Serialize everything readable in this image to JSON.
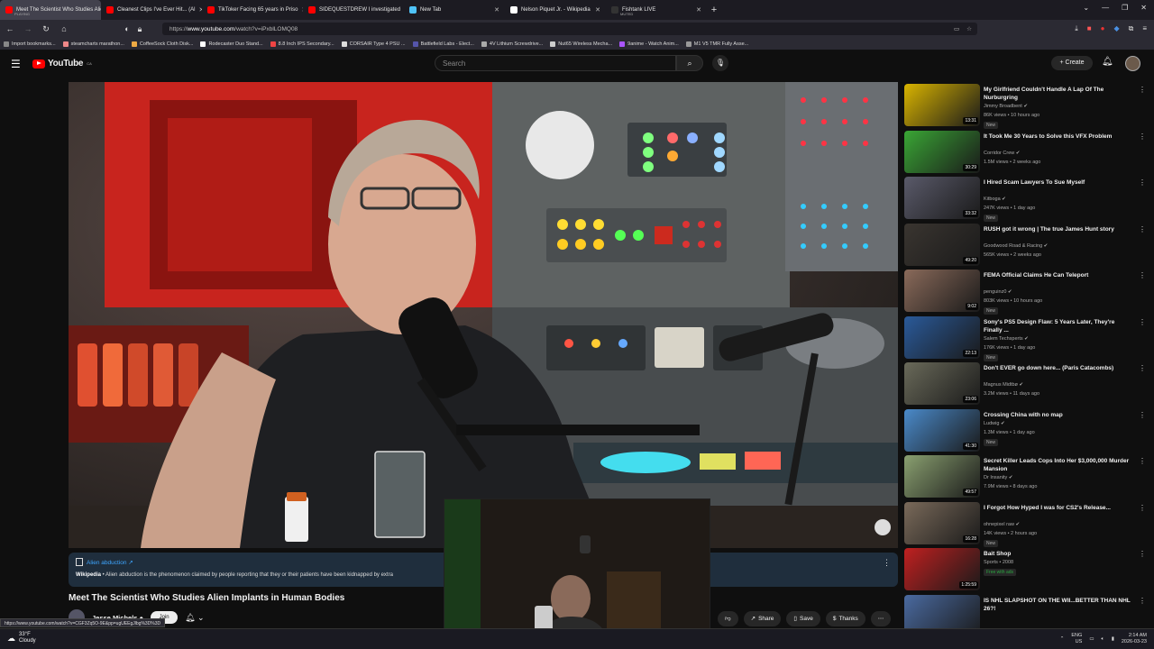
{
  "browser": {
    "tabs": [
      {
        "title": "Meet The Scientist Who Studies Alien",
        "sub": "PLAYING",
        "active": true,
        "color": "#ff0000"
      },
      {
        "title": "Cleanest Clips I've Ever Hit... (Al",
        "color": "#ff0000"
      },
      {
        "title": "TikToker Facing 65 years in Priso",
        "color": "#ff0000"
      },
      {
        "title": "SIDEQUESTDREW I investigated",
        "color": "#ff0000"
      },
      {
        "title": "New Tab",
        "color": "#4fc3f7"
      },
      {
        "title": "Nelson Piquet Jr. - Wikipedia",
        "color": "#ffffff"
      },
      {
        "title": "Fishtank LIVE",
        "sub": "MUTED",
        "color": "#333333"
      }
    ],
    "url_prefix": "https://",
    "url_domain": "www.youtube.com",
    "url_rest": "/watch?v=iPxblLOMQ08",
    "bookmarks": [
      "Import bookmarks...",
      "steamcharts marathon...",
      "CoffeeSock Cloth Disk...",
      "Rodecaster Duo Stand...",
      "8.8 Inch IPS Secondary...",
      "CORSAIR Type 4 PSU ...",
      "Battlefield Labs - Elect...",
      "4V Lithium Screwdrive...",
      "Nut65 Wireless Mecha...",
      "9anime - Watch Anim...",
      "M1 V5 TMR Fully Asse..."
    ],
    "status_url": "https://www.youtube.com/watch?v=CGF3Zq5O-9E&pp=ugUEEgJlbg%3D%3D"
  },
  "youtube": {
    "logo": "YouTube",
    "region": "CA",
    "search_placeholder": "Search",
    "create_label": "+ Create",
    "infocard": {
      "title": "Alien abduction ↗",
      "source": "Wikipedia",
      "text": " • Alien abduction is the phenomenon claimed by people reporting that they or their patients have been kidnapped by extra"
    },
    "video_title": "Meet The Scientist Who Studies Alien Implants in Human Bodies",
    "channel_name": "Jesse Michels ●",
    "subscribe_label": "Join",
    "actions": {
      "share": "Share",
      "save": "Save",
      "thanks": "Thanks"
    }
  },
  "recommendations": [
    {
      "title": "My Girlfriend Couldn't Handle A Lap Of The Nurburgring",
      "channel": "Jimmy Broadbent ✔",
      "meta": "86K views • 10 hours ago",
      "badge": "New",
      "duration": "13:31",
      "color": "#d9b400"
    },
    {
      "title": "It Took Me 30 Years to Solve this VFX Problem",
      "channel": "Corridor Crew ✔",
      "meta": "1.5M views • 2 weeks ago",
      "duration": "30:29",
      "color": "#3aa635"
    },
    {
      "title": "I Hired Scam Lawyers To Sue Myself",
      "channel": "Kitboga ✔",
      "meta": "247K views • 1 day ago",
      "badge": "New",
      "duration": "33:32",
      "color": "#5a5a6a"
    },
    {
      "title": "RUSH got it wrong | The true James Hunt story",
      "channel": "Goodwood Road & Racing ✔",
      "meta": "565K views • 2 weeks ago",
      "duration": "49:20",
      "color": "#3a3530"
    },
    {
      "title": "FEMA Official Claims He Can Teleport",
      "channel": "penguinz0 ✔",
      "meta": "803K views • 10 hours ago",
      "badge": "New",
      "duration": "9:02",
      "color": "#8a6a5a"
    },
    {
      "title": "Sony's PS5 Design Flaw: 5 Years Later, They're Finally ...",
      "channel": "Salem Techsperts ✔",
      "meta": "176K views • 1 day ago",
      "badge": "New",
      "duration": "22:13",
      "color": "#2a5a9a"
    },
    {
      "title": "Don't EVER go down here... (Paris Catacombs)",
      "channel": "Magnus Midtbø ✔",
      "meta": "3.2M views • 11 days ago",
      "duration": "23:06",
      "color": "#6a6a5a"
    },
    {
      "title": "Crossing China with no map",
      "channel": "Ludwig ✔",
      "meta": "1.3M views • 1 day ago",
      "badge": "New",
      "duration": "41:30",
      "color": "#4a8aca"
    },
    {
      "title": "Secret Killer Leads Cops Into Her $3,000,000 Murder Mansion",
      "channel": "Dr Insanity ✔",
      "meta": "7.9M views • 8 days ago",
      "duration": "49:57",
      "color": "#8aa070"
    },
    {
      "title": "I Forgot How Hyped I was for CS2's Release...",
      "channel": "ohnepixel raw ✔",
      "meta": "14K views • 2 hours ago",
      "badge": "New",
      "duration": "16:28",
      "color": "#7a6a5a"
    },
    {
      "title": "Bait Shop",
      "channel": "Sports • 2008",
      "meta": "",
      "badge": "Free with ads",
      "badge_green": true,
      "duration": "1:25:59",
      "color": "#c02020"
    },
    {
      "title": "IS NHL SLAPSHOT ON THE WII...BETTER THAN NHL 26?!",
      "channel": "",
      "meta": "",
      "duration": "",
      "color": "#4a6aa0"
    }
  ],
  "taskbar": {
    "temp": "33°F",
    "condition": "Cloudy",
    "lang1": "ENG",
    "lang2": "US",
    "time": "2:14 AM",
    "date": "2026-03-23"
  }
}
